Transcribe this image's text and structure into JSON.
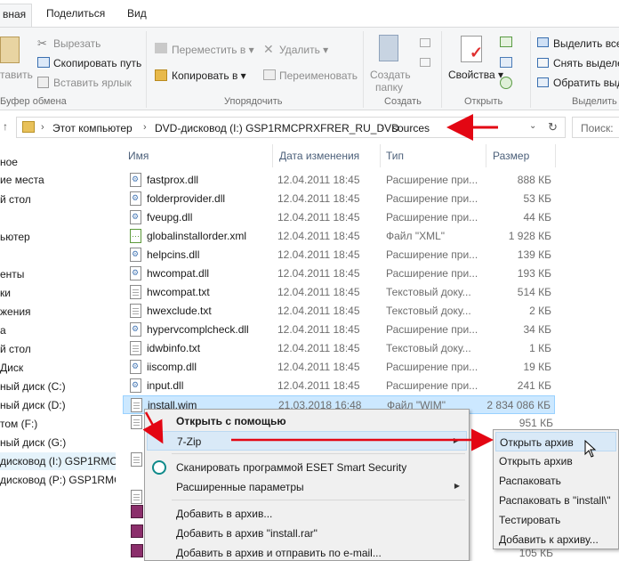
{
  "ribbon_tabs": [
    "вная",
    "Поделиться",
    "Вид"
  ],
  "ribbon": {
    "clipboard": {
      "pin_label": "тавить",
      "cut": "Вырезать",
      "copy_path": "Скопировать путь",
      "paste_shortcut": "Вставить ярлык",
      "group": "Буфер обмена"
    },
    "organize": {
      "move_to": "Переместить в",
      "copy_to": "Копировать в",
      "delete": "Удалить",
      "rename": "Переименовать",
      "group": "Упорядочить"
    },
    "new": {
      "new_folder_1": "Создать",
      "new_folder_2": "папку",
      "group": "Создать"
    },
    "open": {
      "properties": "Свойства",
      "group": "Открыть"
    },
    "select": {
      "select_all": "Выделить все",
      "select_none": "Снять выделе",
      "invert": "Обратить выд",
      "group": "Выделить"
    }
  },
  "address": {
    "crumbs": [
      "Этот компьютер",
      "DVD-дисковод (I:) GSP1RMCPRXFRER_RU_DVD",
      "sources"
    ],
    "search_placeholder": "Поиск:"
  },
  "nav_items": [
    "ное",
    "ие места",
    "й стол",
    "",
    "ьютер",
    "",
    "енты",
    "ки",
    "жения",
    "а",
    "й стол",
    "Диск",
    "ный диск (C:)",
    "ный диск (D:)",
    "том (F:)",
    "ный диск (G:)",
    "дисковод (I:) GSP1RMCPF",
    "дисковод (P:) GSP1RMCP"
  ],
  "columns": {
    "name": "Имя",
    "date": "Дата изменения",
    "type": "Тип",
    "size": "Размер"
  },
  "files": [
    {
      "name": "fastprox.dll",
      "date": "12.04.2011 18:45",
      "type": "Расширение при...",
      "size": "888 КБ",
      "icon": "dll"
    },
    {
      "name": "folderprovider.dll",
      "date": "12.04.2011 18:45",
      "type": "Расширение при...",
      "size": "53 КБ",
      "icon": "dll"
    },
    {
      "name": "fveupg.dll",
      "date": "12.04.2011 18:45",
      "type": "Расширение при...",
      "size": "44 КБ",
      "icon": "dll"
    },
    {
      "name": "globalinstallorder.xml",
      "date": "12.04.2011 18:45",
      "type": "Файл \"XML\"",
      "size": "1 928 КБ",
      "icon": "xml"
    },
    {
      "name": "helpcins.dll",
      "date": "12.04.2011 18:45",
      "type": "Расширение при...",
      "size": "139 КБ",
      "icon": "dll"
    },
    {
      "name": "hwcompat.dll",
      "date": "12.04.2011 18:45",
      "type": "Расширение при...",
      "size": "193 КБ",
      "icon": "dll"
    },
    {
      "name": "hwcompat.txt",
      "date": "12.04.2011 18:45",
      "type": "Текстовый доку...",
      "size": "514 КБ",
      "icon": "txt"
    },
    {
      "name": "hwexclude.txt",
      "date": "12.04.2011 18:45",
      "type": "Текстовый доку...",
      "size": "2 КБ",
      "icon": "txt"
    },
    {
      "name": "hypervcomplcheck.dll",
      "date": "12.04.2011 18:45",
      "type": "Расширение при...",
      "size": "34 КБ",
      "icon": "dll"
    },
    {
      "name": "idwbinfo.txt",
      "date": "12.04.2011 18:45",
      "type": "Текстовый доку...",
      "size": "1 КБ",
      "icon": "txt"
    },
    {
      "name": "iiscomp.dll",
      "date": "12.04.2011 18:45",
      "type": "Расширение при...",
      "size": "19 КБ",
      "icon": "dll"
    },
    {
      "name": "input.dll",
      "date": "12.04.2011 18:45",
      "type": "Расширение при...",
      "size": "241 КБ",
      "icon": "dll"
    },
    {
      "name": "install.wim",
      "date": "21.03.2018 16:48",
      "type": "Файл \"WIM\"",
      "size": "2 834 086 КБ",
      "icon": "txt",
      "selected": true
    }
  ],
  "hidden_sizes": [
    "951 КБ",
    "105 КБ"
  ],
  "context_menu": {
    "open_with": "Открыть с помощью",
    "sevenzip": "7-Zip",
    "eset": "Сканировать программой ESET Smart Security",
    "advanced": "Расширенные параметры",
    "add_archive": "Добавить в архив...",
    "add_rar": "Добавить в архив \"install.rar\"",
    "add_email": "Добавить в архив и отправить по e-mail..."
  },
  "submenu": [
    "Открыть архив",
    "Открыть архив",
    "Распаковать",
    "Распаковать в \"install\\\"",
    "Тестировать",
    "Добавить к архиву..."
  ],
  "colors": {
    "accent": "#0078d7",
    "selection": "#cce8ff",
    "menu_hover": "#d9e9f7",
    "annotation_red": "#e30613"
  }
}
